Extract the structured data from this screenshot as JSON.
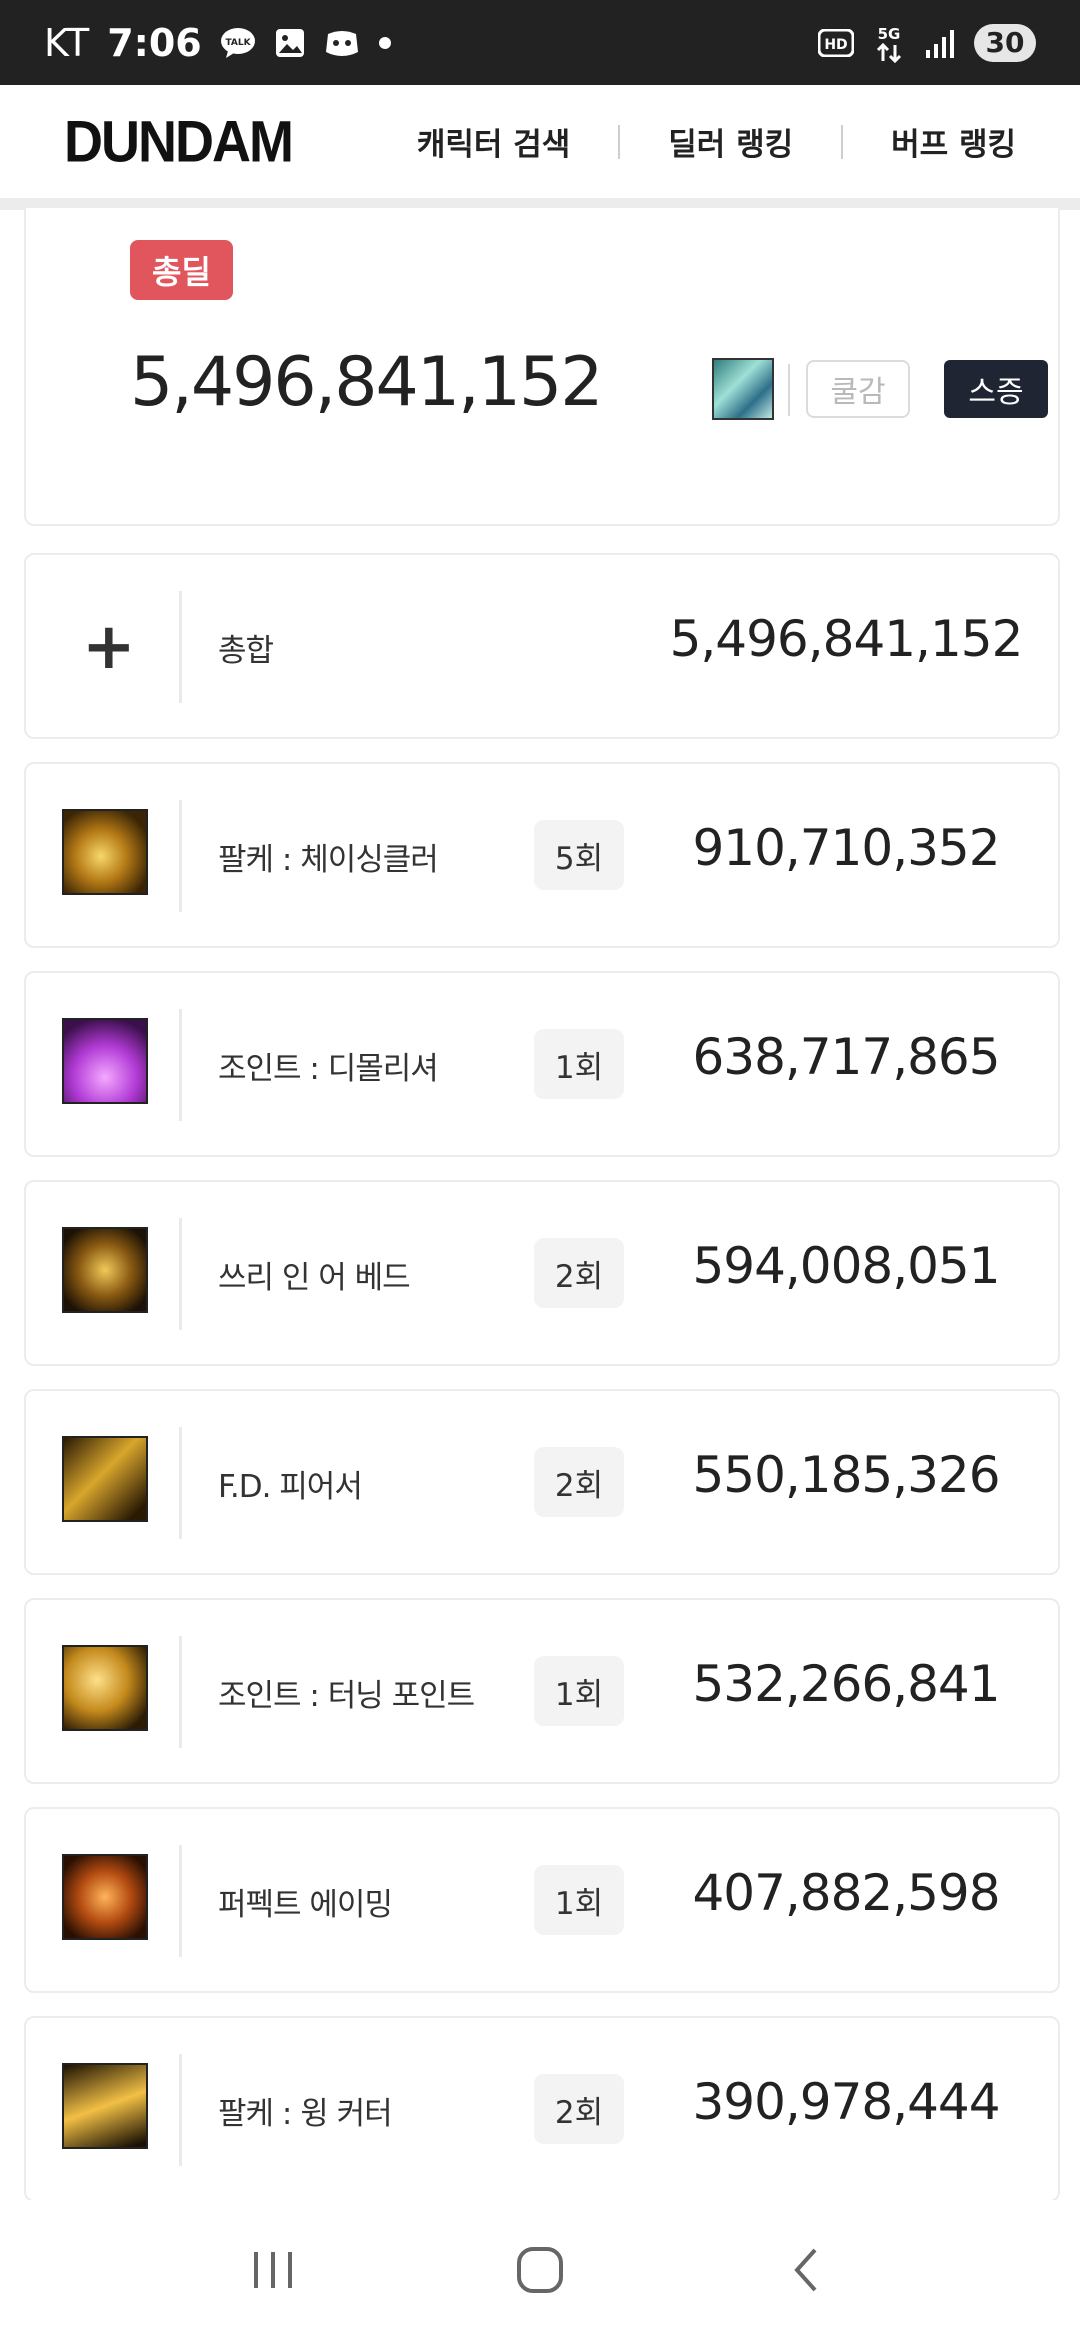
{
  "status_bar": {
    "carrier": "KT",
    "time": "7:06",
    "battery": "30"
  },
  "nav": {
    "logo": "DUNDAM",
    "links": [
      "캐릭터 검색",
      "딜러 랭킹",
      "버프 랭킹"
    ]
  },
  "summary": {
    "badge": "총딜",
    "total": "5,496,841,152",
    "cool_button": "쿨감",
    "stack_button": "스증"
  },
  "rows": [
    {
      "name": "총합",
      "count": "",
      "value": "5,496,841,152",
      "icon": "plus-icon"
    },
    {
      "name": "팔케 : 체이싱클러",
      "count": "5회",
      "value": "910,710,352",
      "icon": "skill-icon"
    },
    {
      "name": "조인트 : 디몰리셔",
      "count": "1회",
      "value": "638,717,865",
      "icon": "skill-icon"
    },
    {
      "name": "쓰리 인 어 베드",
      "count": "2회",
      "value": "594,008,051",
      "icon": "skill-icon"
    },
    {
      "name": "F.D. 피어서",
      "count": "2회",
      "value": "550,185,326",
      "icon": "skill-icon"
    },
    {
      "name": "조인트 : 터닝 포인트",
      "count": "1회",
      "value": "532,266,841",
      "icon": "skill-icon"
    },
    {
      "name": "퍼펙트 에이밍",
      "count": "1회",
      "value": "407,882,598",
      "icon": "skill-icon"
    },
    {
      "name": "팔케 : 윙 커터",
      "count": "2회",
      "value": "390,978,444",
      "icon": "skill-icon"
    }
  ],
  "bottom_nav": [
    "recent-apps-icon",
    "home-icon",
    "back-icon"
  ]
}
